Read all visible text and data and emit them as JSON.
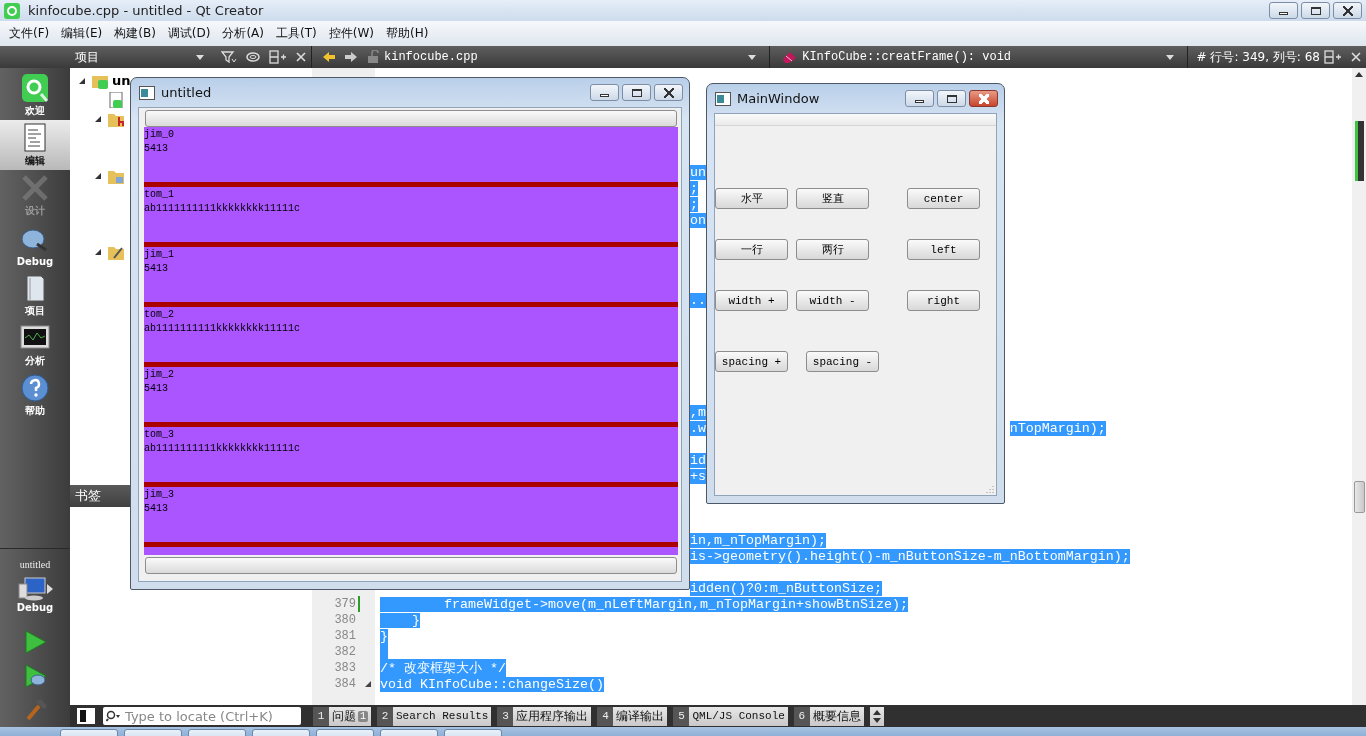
{
  "window": {
    "title": "kinfocube.cpp - untitled - Qt Creator"
  },
  "menu_bar": [
    "文件(F)",
    "编辑(E)",
    "构建(B)",
    "调试(D)",
    "分析(A)",
    "工具(T)",
    "控件(W)",
    "帮助(H)"
  ],
  "sidebar_toolbar": {
    "view": "项目"
  },
  "editor_toolbar": {
    "file": "kinfocube.cpp",
    "symbol": "KInfoCube::creatFrame(): void",
    "hash": "#",
    "position": "行号: 349, 列号: 68"
  },
  "mode_bar": {
    "modes": [
      {
        "label": "欢迎",
        "kind": "welcome",
        "selected": false,
        "disabled": false
      },
      {
        "label": "编辑",
        "kind": "edit",
        "selected": true,
        "disabled": false
      },
      {
        "label": "设计",
        "kind": "design",
        "selected": false,
        "disabled": true
      },
      {
        "label": "Debug",
        "kind": "debug",
        "selected": false,
        "disabled": false
      },
      {
        "label": "项目",
        "kind": "projects",
        "selected": false,
        "disabled": false
      },
      {
        "label": "分析",
        "kind": "analyze",
        "selected": false,
        "disabled": false
      },
      {
        "label": "帮助",
        "kind": "help",
        "selected": false,
        "disabled": false
      }
    ],
    "project": "untitled",
    "kit": "Debug"
  },
  "project_tree": [
    {
      "label": "un",
      "kind": "project",
      "expanded": true,
      "children": [
        {
          "kind": "pro"
        },
        {
          "kind": "headers",
          "expanded": true
        },
        {
          "kind": "sources",
          "expanded": true
        },
        {
          "kind": "forms",
          "expanded": true
        }
      ]
    }
  ],
  "bookmarks": {
    "title": "书签"
  },
  "editor": {
    "lines": [
      {
        "selected": true,
        "parts": [
          {
            "kind": "between_windows",
            "text": "un"
          }
        ]
      },
      {
        "selected": true,
        "parts": [
          {
            "kind": "between_windows",
            "text": ";"
          }
        ]
      },
      {
        "selected": true,
        "parts": [
          {
            "kind": "between_windows",
            "text": ";"
          }
        ]
      },
      {
        "selected": true,
        "parts": [
          {
            "kind": "between_windows",
            "text": "on"
          }
        ]
      },
      {
        "kind": "covered"
      },
      {
        "kind": "covered"
      },
      {
        "kind": "covered"
      },
      {
        "kind": "covered"
      },
      {
        "selected": true,
        "parts": [
          {
            "kind": "between_windows",
            "text": ".."
          }
        ]
      },
      {
        "kind": "covered"
      },
      {
        "kind": "covered"
      },
      {
        "kind": "covered"
      },
      {
        "kind": "covered"
      },
      {
        "kind": "covered"
      },
      {
        "kind": "covered"
      },
      {
        "selected": true,
        "parts": [
          {
            "kind": "between_windows",
            "text": ",m"
          }
        ]
      },
      {
        "selected": true,
        "parts": [
          {
            "kind": "between_windows",
            "text": ".w"
          },
          {
            "kind": "right_of_window",
            "text": "nTopMargin);"
          }
        ]
      },
      {
        "kind": "covered"
      },
      {
        "selected": true,
        "parts": [
          {
            "kind": "between_windows",
            "text": "id"
          }
        ]
      },
      {
        "selected": true,
        "parts": [
          {
            "kind": "between_windows",
            "text": "+s"
          }
        ]
      },
      {
        "kind": "covered"
      },
      {
        "kind": "covered"
      },
      {
        "kind": "covered"
      },
      {
        "selected": true,
        "parts": [
          {
            "kind": "between_windows",
            "text": "in,m_nTopMargin);"
          }
        ]
      },
      {
        "selected": true,
        "parts": [
          {
            "kind": "between_windows",
            "text": "is->geometry().height()-m_nButtonSize-m_nBottomMargin);"
          }
        ]
      },
      {
        "kind": "covered"
      },
      {
        "selected": true,
        "parts": [
          {
            "kind": "between_windows",
            "text": "idden()?0:m_nButtonSize;"
          }
        ]
      },
      {
        "number": "379",
        "changed": true,
        "selected": true,
        "parts": [
          {
            "kind": "code",
            "text": "        frameWidget->move(m_nLeftMargin,m_nTopMargin+showBtnSize);"
          }
        ]
      },
      {
        "number": "380",
        "selected": true,
        "parts": [
          {
            "kind": "code",
            "text": "    }"
          }
        ]
      },
      {
        "number": "381",
        "selected": true,
        "parts": [
          {
            "kind": "code",
            "text": "}"
          }
        ]
      },
      {
        "number": "382",
        "selected": true
      },
      {
        "number": "383",
        "selected": true,
        "parts": [
          {
            "kind": "code",
            "text": "/* 改变框架大小 */"
          }
        ]
      },
      {
        "number": "384",
        "expanded": true,
        "selected": true,
        "parts": [
          {
            "kind": "code",
            "text": "void KInfoCube::changeSize()"
          }
        ]
      }
    ]
  },
  "output_bar": {
    "locate": {
      "placeholder": "Type to locate (Ctrl+K)"
    },
    "panes": [
      {
        "number": "1",
        "label": "问题",
        "badge": "1"
      },
      {
        "number": "2",
        "label": "Search Results"
      },
      {
        "number": "3",
        "label": "应用程序输出"
      },
      {
        "number": "4",
        "label": "编译输出"
      },
      {
        "number": "5",
        "label": "QML/JS Console"
      },
      {
        "number": "6",
        "label": "概要信息"
      }
    ]
  },
  "untitled_window": {
    "title": "untitled",
    "items": [
      {
        "name": "jim_0",
        "value": "5413"
      },
      {
        "name": "tom_1",
        "value": "ab1111111111kkkkkkkk11111c"
      },
      {
        "name": "jim_1",
        "value": "5413"
      },
      {
        "name": "tom_2",
        "value": "ab1111111111kkkkkkkk11111c"
      },
      {
        "name": "jim_2",
        "value": "5413"
      },
      {
        "name": "tom_3",
        "value": "ab1111111111kkkkkkkk11111c"
      },
      {
        "name": "jim_3",
        "value": "5413"
      }
    ]
  },
  "main_window": {
    "title": "MainWindow",
    "button_rows": [
      [
        "水平",
        "竖直",
        "center"
      ],
      [
        "一行",
        "两行",
        "left"
      ],
      [
        "width +",
        "width -",
        "right"
      ],
      [
        "spacing +",
        "spacing -"
      ]
    ]
  }
}
